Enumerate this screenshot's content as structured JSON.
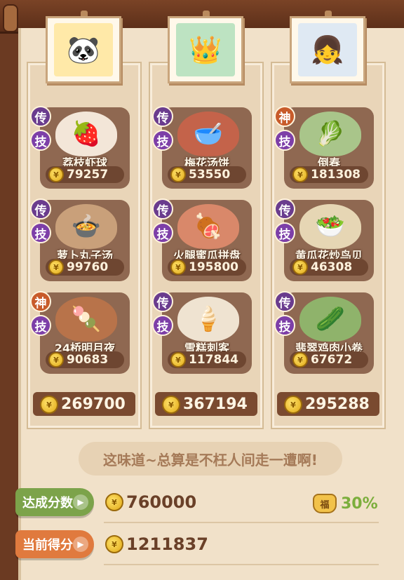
{
  "columns": [
    {
      "portrait_icon": "🐼",
      "portrait_bg": "#ffe9a8",
      "dishes": [
        {
          "top_badge": "传",
          "bottom_badge": "技",
          "name": "荔枝虾球",
          "score": "79257",
          "art": "🍓",
          "art_bg": "#f3e6d8"
        },
        {
          "top_badge": "传",
          "bottom_badge": "技",
          "name": "萝卜丸子汤",
          "score": "99760",
          "art": "🍲",
          "art_bg": "#c9a07a"
        },
        {
          "top_badge": "神",
          "bottom_badge": "技",
          "name": "24桥明月夜",
          "score": "90683",
          "art": "🍡",
          "art_bg": "#b8734a"
        }
      ],
      "total": "269700"
    },
    {
      "portrait_icon": "👑",
      "portrait_bg": "#bde3c2",
      "dishes": [
        {
          "top_badge": "传",
          "bottom_badge": "技",
          "name": "梅花汤饼",
          "score": "53550",
          "art": "🥣",
          "art_bg": "#c4634a"
        },
        {
          "top_badge": "传",
          "bottom_badge": "技",
          "name": "火腿蜜瓜拼盘",
          "score": "195800",
          "art": "🍖",
          "art_bg": "#d9886a"
        },
        {
          "top_badge": "传",
          "bottom_badge": "技",
          "name": "雪糕刺客",
          "score": "117844",
          "art": "🍦",
          "art_bg": "#efe3d1"
        }
      ],
      "total": "367194"
    },
    {
      "portrait_icon": "👧",
      "portrait_bg": "#dfe9f3",
      "dishes": [
        {
          "top_badge": "神",
          "bottom_badge": "技",
          "name": "倒春",
          "score": "181308",
          "art": "🥬",
          "art_bg": "#a9c58a"
        },
        {
          "top_badge": "传",
          "bottom_badge": "技",
          "name": "黄瓜花炒鸟贝",
          "score": "46308",
          "art": "🥗",
          "art_bg": "#e6d6b4"
        },
        {
          "top_badge": "传",
          "bottom_badge": "技",
          "name": "翡翠鸡肉小卷",
          "score": "67672",
          "art": "🥒",
          "art_bg": "#8fb36b"
        }
      ],
      "total": "295288"
    }
  ],
  "quote": "这味道~总算是不枉人间走一遭啊!",
  "target": {
    "label": "达成分数",
    "value": "760000"
  },
  "current": {
    "label": "当前得分",
    "value": "1211837"
  },
  "bonus": {
    "value": "30%"
  },
  "icons": {
    "coin": "coin-icon",
    "bag": "lucky-bag-icon",
    "arrow": "arrow-right-icon"
  },
  "colors": {
    "chuan_badge": "#6a3c8e",
    "shen_badge": "#c85b2a",
    "ji_badge": "#7d3fa8",
    "target_tag": "#7ca34a",
    "current_tag": "#e07a3e",
    "bonus": "#7cae3c"
  }
}
